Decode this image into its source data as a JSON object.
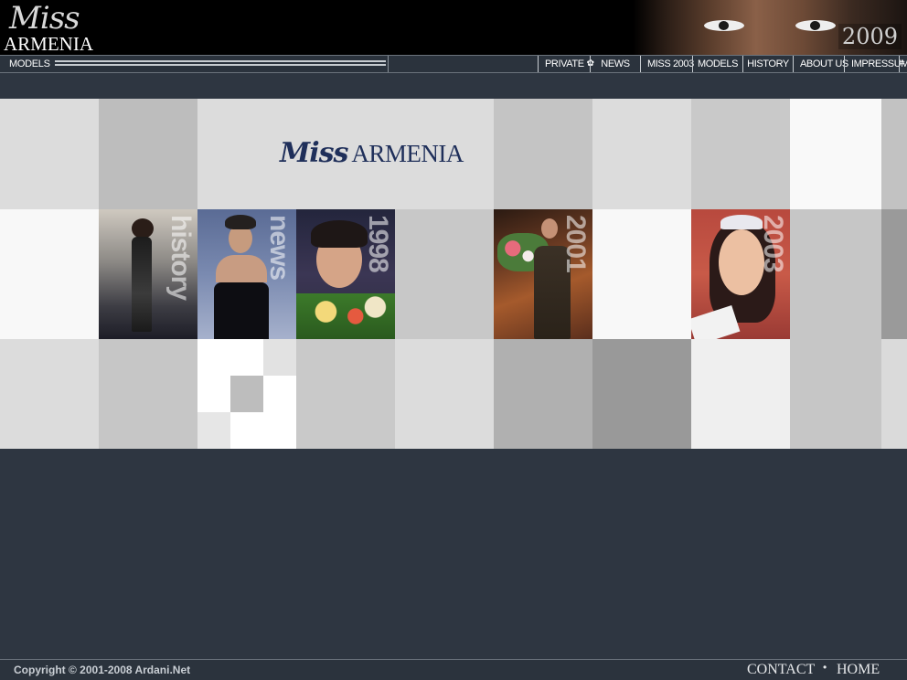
{
  "header": {
    "logo_script": "Miss",
    "logo_word": "ARMENIA",
    "year": "2009"
  },
  "menubar": {
    "models_label": "MODELS",
    "nav": [
      {
        "label": "PRIVATE",
        "icon": "star-icon"
      },
      {
        "label": "NEWS"
      },
      {
        "label": "MISS 2003"
      },
      {
        "label": "MODELS"
      },
      {
        "label": "HISTORY"
      },
      {
        "label": "ABOUT US"
      },
      {
        "label": "IMPRESSUM"
      }
    ]
  },
  "center_logo": {
    "script": "Miss",
    "word": "ARMENIA"
  },
  "photos": [
    {
      "name": "history",
      "label": "history"
    },
    {
      "name": "news",
      "label": "news"
    },
    {
      "name": "1998",
      "label": "1998"
    },
    {
      "name": "2001",
      "label": "2001"
    },
    {
      "name": "2003",
      "label": "2003"
    }
  ],
  "footer": {
    "copyright": "Copyright © 2001-2008 Ardani.Net",
    "contact": "CONTACT",
    "separator": "•",
    "home": "HOME"
  },
  "colors": {
    "background": "#2e3641",
    "header_bg": "#000000",
    "logo_blue": "#1f2f5a"
  }
}
